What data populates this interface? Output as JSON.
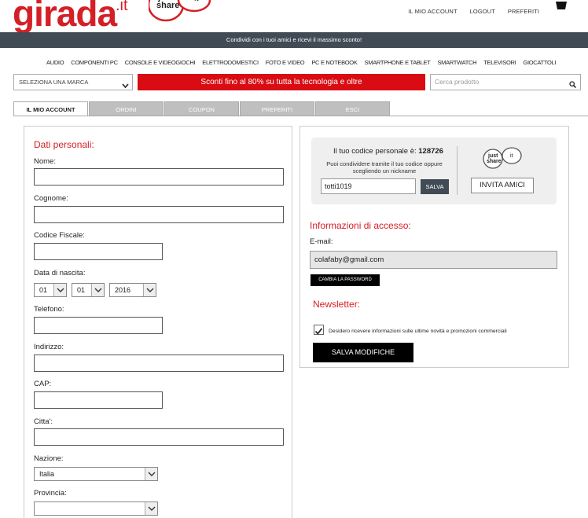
{
  "header": {
    "logo_text": "girada",
    "logo_suffix": ".it",
    "logo_bubble_line1": "just",
    "logo_bubble_line2": "share",
    "logo_bubble_it": "it",
    "links": [
      "IL MIO ACCOUNT",
      "LOGOUT",
      "PREFERITI"
    ]
  },
  "promo_bar": "Condividi con i tuoi amici e ricevi il massimo sconto!",
  "nav": [
    "AUDIO",
    "COMPONENTI PC",
    "CONSOLE E VIDEOGIOCHI",
    "ELETTRODOMESTICI",
    "FOTO E VIDEO",
    "PC E NOTEBOOK",
    "SMARTPHONE E TABLET",
    "SMARTWATCH",
    "TELEVISORI",
    "GIOCATTOLI"
  ],
  "brand_select": "SELEZIONA UNA MARCA",
  "banner": "Sconti fino al 80% su tutta la tecnologia e oltre",
  "search_placeholder": "Cerca prodotto",
  "tabs": [
    "IL MIO ACCOUNT",
    "ORDINI",
    "COUPON",
    "PREFERITI",
    "ESCI"
  ],
  "personal": {
    "title": "Dati personali:",
    "nome_label": "Nome:",
    "cognome_label": "Cognome:",
    "cf_label": "Codice Fiscale:",
    "nascita_label": "Data di nascita:",
    "day": "01",
    "month": "01",
    "year": "2016",
    "telefono_label": "Telefono:",
    "indirizzo_label": "Indirizzo:",
    "cap_label": "CAP:",
    "citta_label": "Citta':",
    "nazione_label": "Nazione:",
    "nazione_value": "Italia",
    "provincia_label": "Provincia:",
    "provincia_value": ""
  },
  "code": {
    "title_prefix": "Il tuo codice personale è: ",
    "code": "128726",
    "subtitle": "Puoi condividere tramite il tuo codice oppure scegliendo un nickname",
    "nickname": "totti1019",
    "save_label": "SALVA",
    "invite_label": "INVITA AMICI"
  },
  "access": {
    "title": "Informazioni di accesso:",
    "email_label": "E-mail:",
    "email": "colafaby@gmail.com",
    "change_password": "CAMBIA LA PASSWORD"
  },
  "newsletter": {
    "title": "Newsletter:",
    "checkbox_label": "Desidero ricevere informazioni sulle ultime novità e promozioni commerciali",
    "checked": true,
    "save_changes": "SALVA MODIFICHE"
  },
  "colors": {
    "brand_red": "#d51f26",
    "banner_red": "#d80c12",
    "dark_bar": "#414b56"
  }
}
